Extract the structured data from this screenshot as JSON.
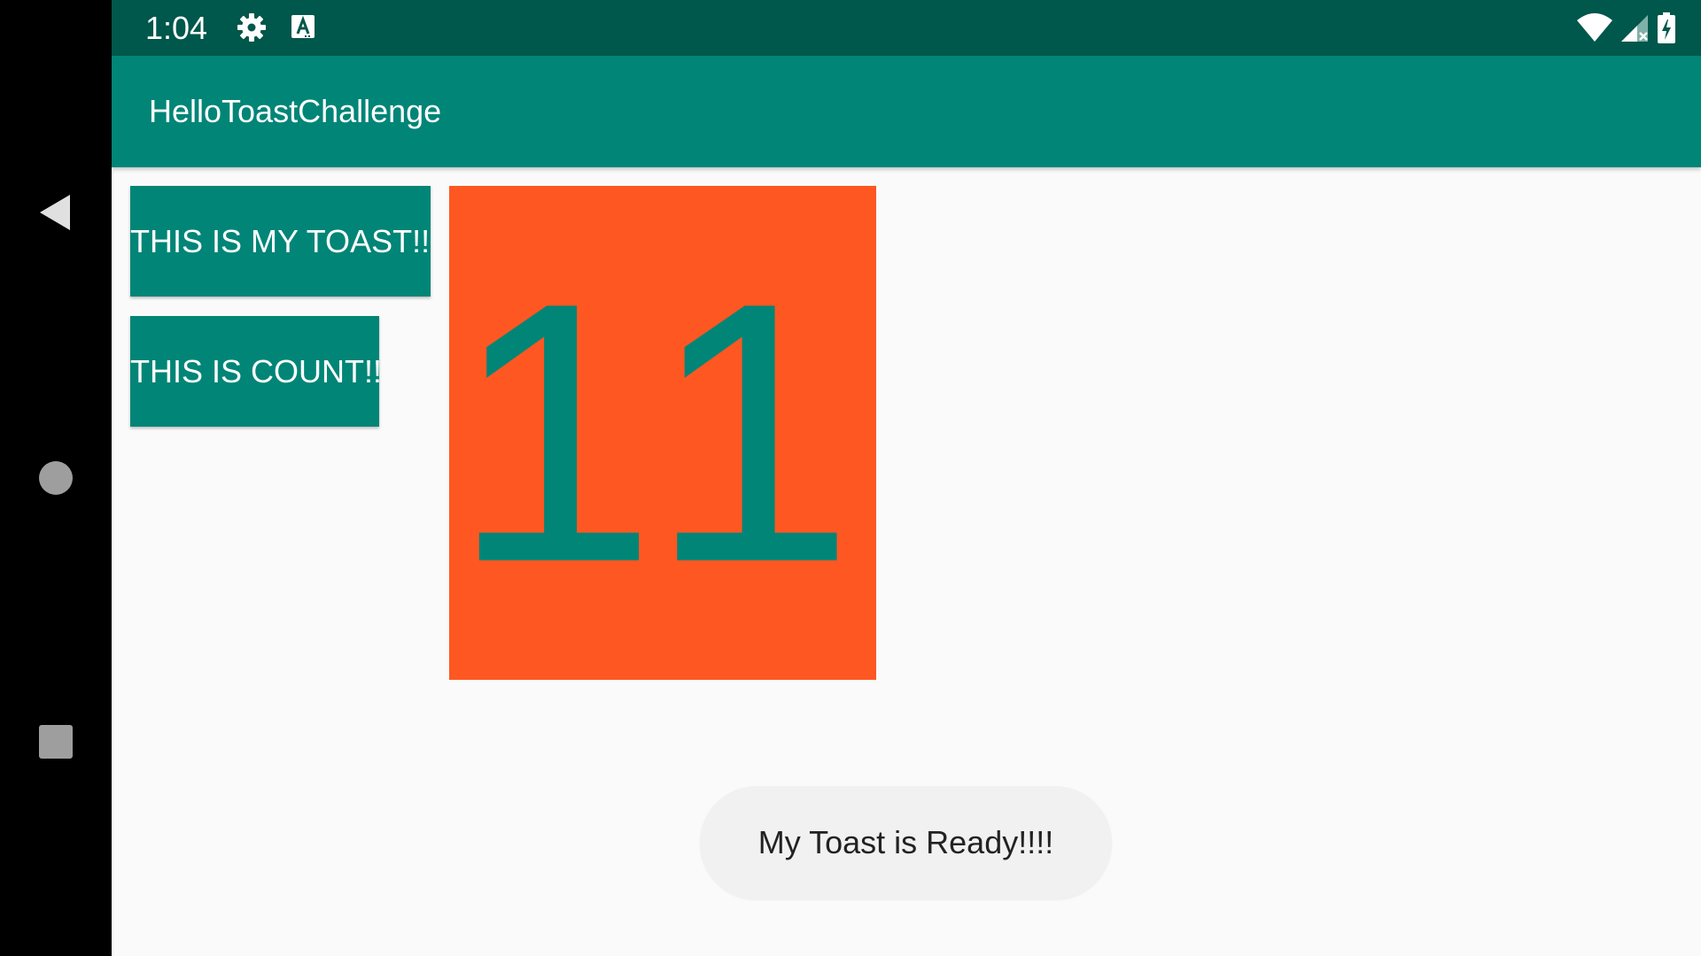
{
  "status_bar": {
    "time": "1:04",
    "icons": [
      "gear-icon",
      "text-a-icon",
      "wifi-icon",
      "signal-icon",
      "battery-charging-icon"
    ]
  },
  "app_bar": {
    "title": "HelloToastChallenge"
  },
  "buttons": {
    "toast_label": "THIS IS MY TOAST!!!",
    "count_label": "THIS IS COUNT!!!"
  },
  "count": {
    "value": "11"
  },
  "toast": {
    "message": "My Toast is Ready!!!!"
  },
  "navigation": {
    "icons": [
      "back-icon",
      "home-icon",
      "recents-icon"
    ]
  },
  "colors": {
    "status_bar": "#00574B",
    "primary": "#008577",
    "count_background": "#FF5722",
    "screen_background": "#FAFAFA",
    "toast_background": "#F1F1F1"
  }
}
